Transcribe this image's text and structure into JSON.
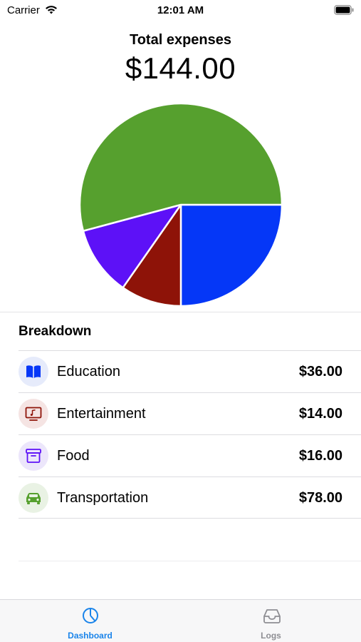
{
  "status_bar": {
    "carrier": "Carrier",
    "time": "12:01 AM",
    "wifi_icon": "wifi-icon",
    "battery_icon": "battery-icon"
  },
  "header": {
    "label": "Total expenses",
    "total": "$144.00"
  },
  "chart_data": {
    "type": "pie",
    "categories": [
      "Education",
      "Entertainment",
      "Food",
      "Transportation"
    ],
    "values": [
      36,
      14,
      16,
      78
    ],
    "colors": [
      "#0537f7",
      "#8e1308",
      "#5d11f7",
      "#56a02e"
    ]
  },
  "breakdown": {
    "title": "Breakdown",
    "items": [
      {
        "label": "Education",
        "amount": "$36.00",
        "icon": "book-icon",
        "color": "#0537f7",
        "bg": "#e6ebfb"
      },
      {
        "label": "Entertainment",
        "amount": "$14.00",
        "icon": "tv-icon",
        "color": "#8e1308",
        "bg": "#f5e4e3"
      },
      {
        "label": "Food",
        "amount": "$16.00",
        "icon": "archive-box-icon",
        "color": "#5d11f7",
        "bg": "#ece6fb"
      },
      {
        "label": "Transportation",
        "amount": "$78.00",
        "icon": "car-icon",
        "color": "#56a02e",
        "bg": "#e9f2e4"
      }
    ]
  },
  "tab_bar": {
    "tabs": [
      {
        "label": "Dashboard",
        "icon": "pie-chart-icon",
        "active": true,
        "color": "#1a84ea"
      },
      {
        "label": "Logs",
        "icon": "tray-icon",
        "active": false,
        "color": "#8e8e93"
      }
    ]
  }
}
